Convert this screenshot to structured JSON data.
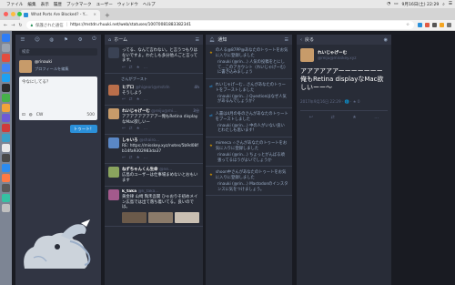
{
  "menubar": {
    "app": "Chrome",
    "items": [
      "ファイル",
      "編集",
      "表示",
      "履歴",
      "ブックマーク",
      "ユーザー",
      "ウィンドウ",
      "ヘルプ"
    ],
    "clock": "9月16日(土) 22:29"
  },
  "browser": {
    "tab_title": "What Ports Are Blocked? - Y...",
    "url_security": "保護された通信",
    "url_sep": "|",
    "url": "https://mstdn.rhuuki.net/web/statuses/10070081883382341"
  },
  "compose": {
    "search_placeholder": "検索",
    "user_name": "@rinauki",
    "user_link": "プロフィールを編集",
    "textarea_placeholder": "今なにしてる？",
    "cw_label": "CW",
    "char_count": "500",
    "toot_label": "トゥート！"
  },
  "home": {
    "title": "ホーム",
    "statuses": [
      {
        "who": "",
        "acct": "",
        "time": "",
        "text": "ってる、なんて言わない。と言うつもりはないですよ。わたしも多分他人ごと言ってます。",
        "avatar": "#3a4254"
      },
      {
        "boost": "さんがブースト",
        "who": "ヒデロ",
        "acct": "@higeori@mstdn",
        "time": "4h",
        "text": "そうしよう",
        "avatar": "#b96e4a"
      },
      {
        "who": "れいじゃげーむ",
        "acct": "@reiju@mi…",
        "time": "3分",
        "text": "アアアアアアアアアー俺もRetina displayなMac欲しいー",
        "avatar": "#c79b6a"
      },
      {
        "who": "しゃいろ",
        "acct": "@shairo…",
        "time": "",
        "text": "RE: https://misskey.xyz/notes/5b9d08fb14fa9302983da37",
        "avatar": "#5a87c5"
      },
      {
        "who": "ねずちゃんくん生命",
        "acct": "@ne…",
        "time": "",
        "text": "広島のユーザーは仕事場まめないとおもいます",
        "avatar": "#8aa45e"
      },
      {
        "who": "k_taka",
        "acct": "@k_taka…",
        "time": "",
        "text": "黄金律 山崎 陶禾吾関 ひゃおりそ初めメイン広島では出て落ち着いてる。良いのでは。",
        "avatar": "#a35a8c"
      }
    ]
  },
  "notifications": {
    "title": "通知",
    "items": [
      {
        "line": "の人る@87PP@あなたのトゥートをお気に入りに登録しました",
        "text": "rinauki (@rin…) 人気の投稿をとにして…このアカウント（れいじゃげーむ）に書き込みましょう"
      },
      {
        "line": "れいじゃげーむ…さんがあなたのトゥートをブーストしました",
        "text": "rinauki (@rin…) Questionはなぜ人気があるんでしょうか？"
      },
      {
        "line": "人書は4月の冬のさんがあなたのトゥートをブーストしました",
        "text": "rinauki (@rin…) 中の人がいない良いとわたしも思います！"
      },
      {
        "line": "mimeca ☆さんがあなたのトゥートをお気に入りに登録しました",
        "text": "rinauki (@rin…) ちょっとがんばる頑張ってるほうがよいでしょうか"
      },
      {
        "line": "shoon中さんがあなたのトゥートをお気に入りに登録しました",
        "text": "rinauki (@rin…) Mastodonのインスタンスに気をつけましょう。"
      }
    ]
  },
  "detail": {
    "back_label": "戻る",
    "name": "れいじゃげーむ",
    "acct": "@reiju@misskey.xyz",
    "text": "アアアアアアーーーーーーー 俺もRetina displayなMac欲しいーー〜",
    "meta": "2017年9月16日 22:29 · 🌐 · ★ 0"
  }
}
